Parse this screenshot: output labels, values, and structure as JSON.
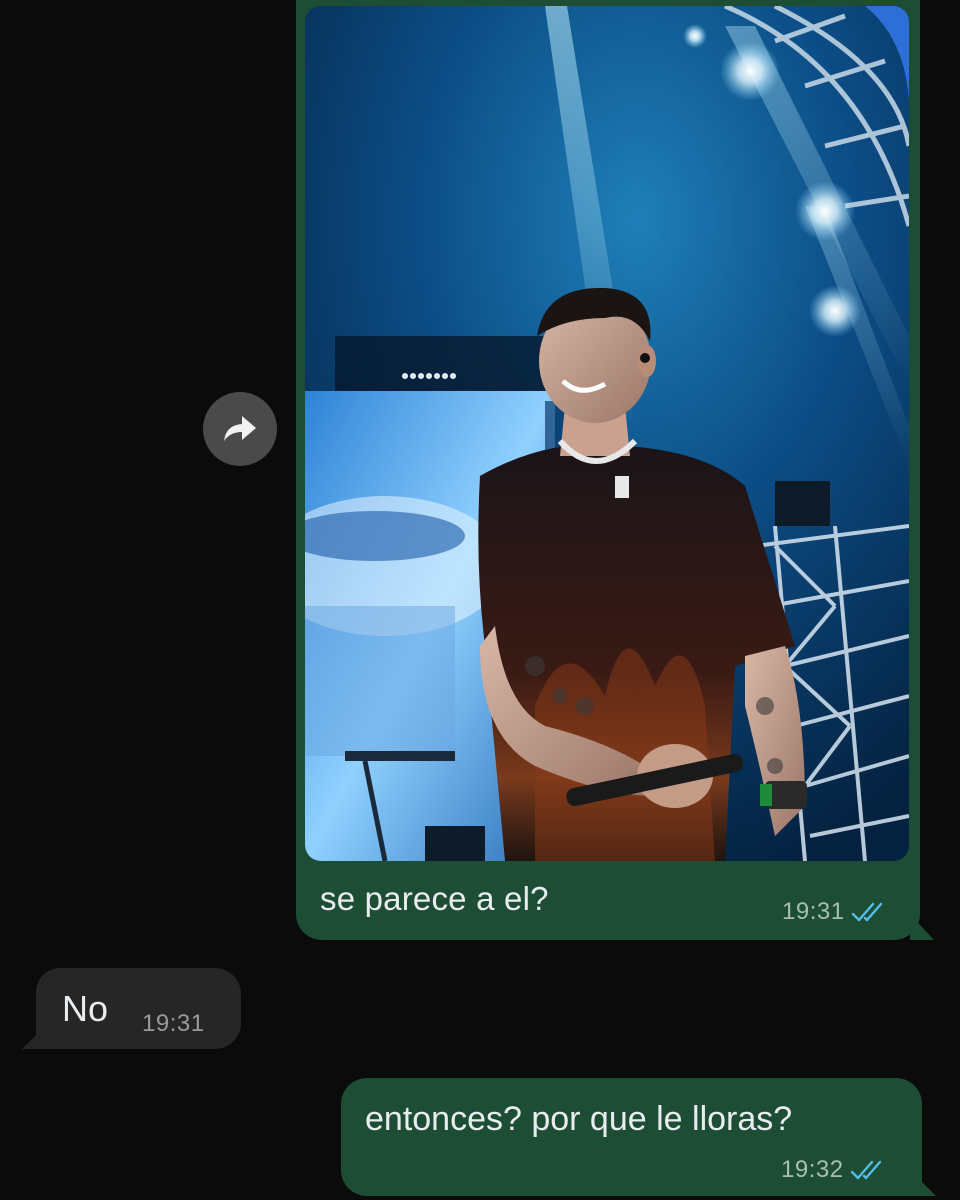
{
  "chat": {
    "messages": [
      {
        "direction": "outgoing",
        "type": "image",
        "caption": "se parece a el?",
        "time": "19:31",
        "status_icon": "double-check-icon",
        "image_description_icon": "concert-photo"
      },
      {
        "direction": "incoming",
        "type": "text",
        "text": "No",
        "time": "19:31"
      },
      {
        "direction": "outgoing",
        "type": "text",
        "text": "entonces? por que le lloras?",
        "time": "19:32",
        "status_icon": "double-check-icon"
      }
    ],
    "forward_icon": "forward-arrow-icon"
  },
  "colors": {
    "background": "#0b0b0b",
    "outgoing_bubble": "#1d4e35",
    "incoming_bubble": "#262626",
    "read_check": "#53bdeb",
    "meta_text": "#a9bdb2",
    "forward_button": "#4a4a4a"
  }
}
